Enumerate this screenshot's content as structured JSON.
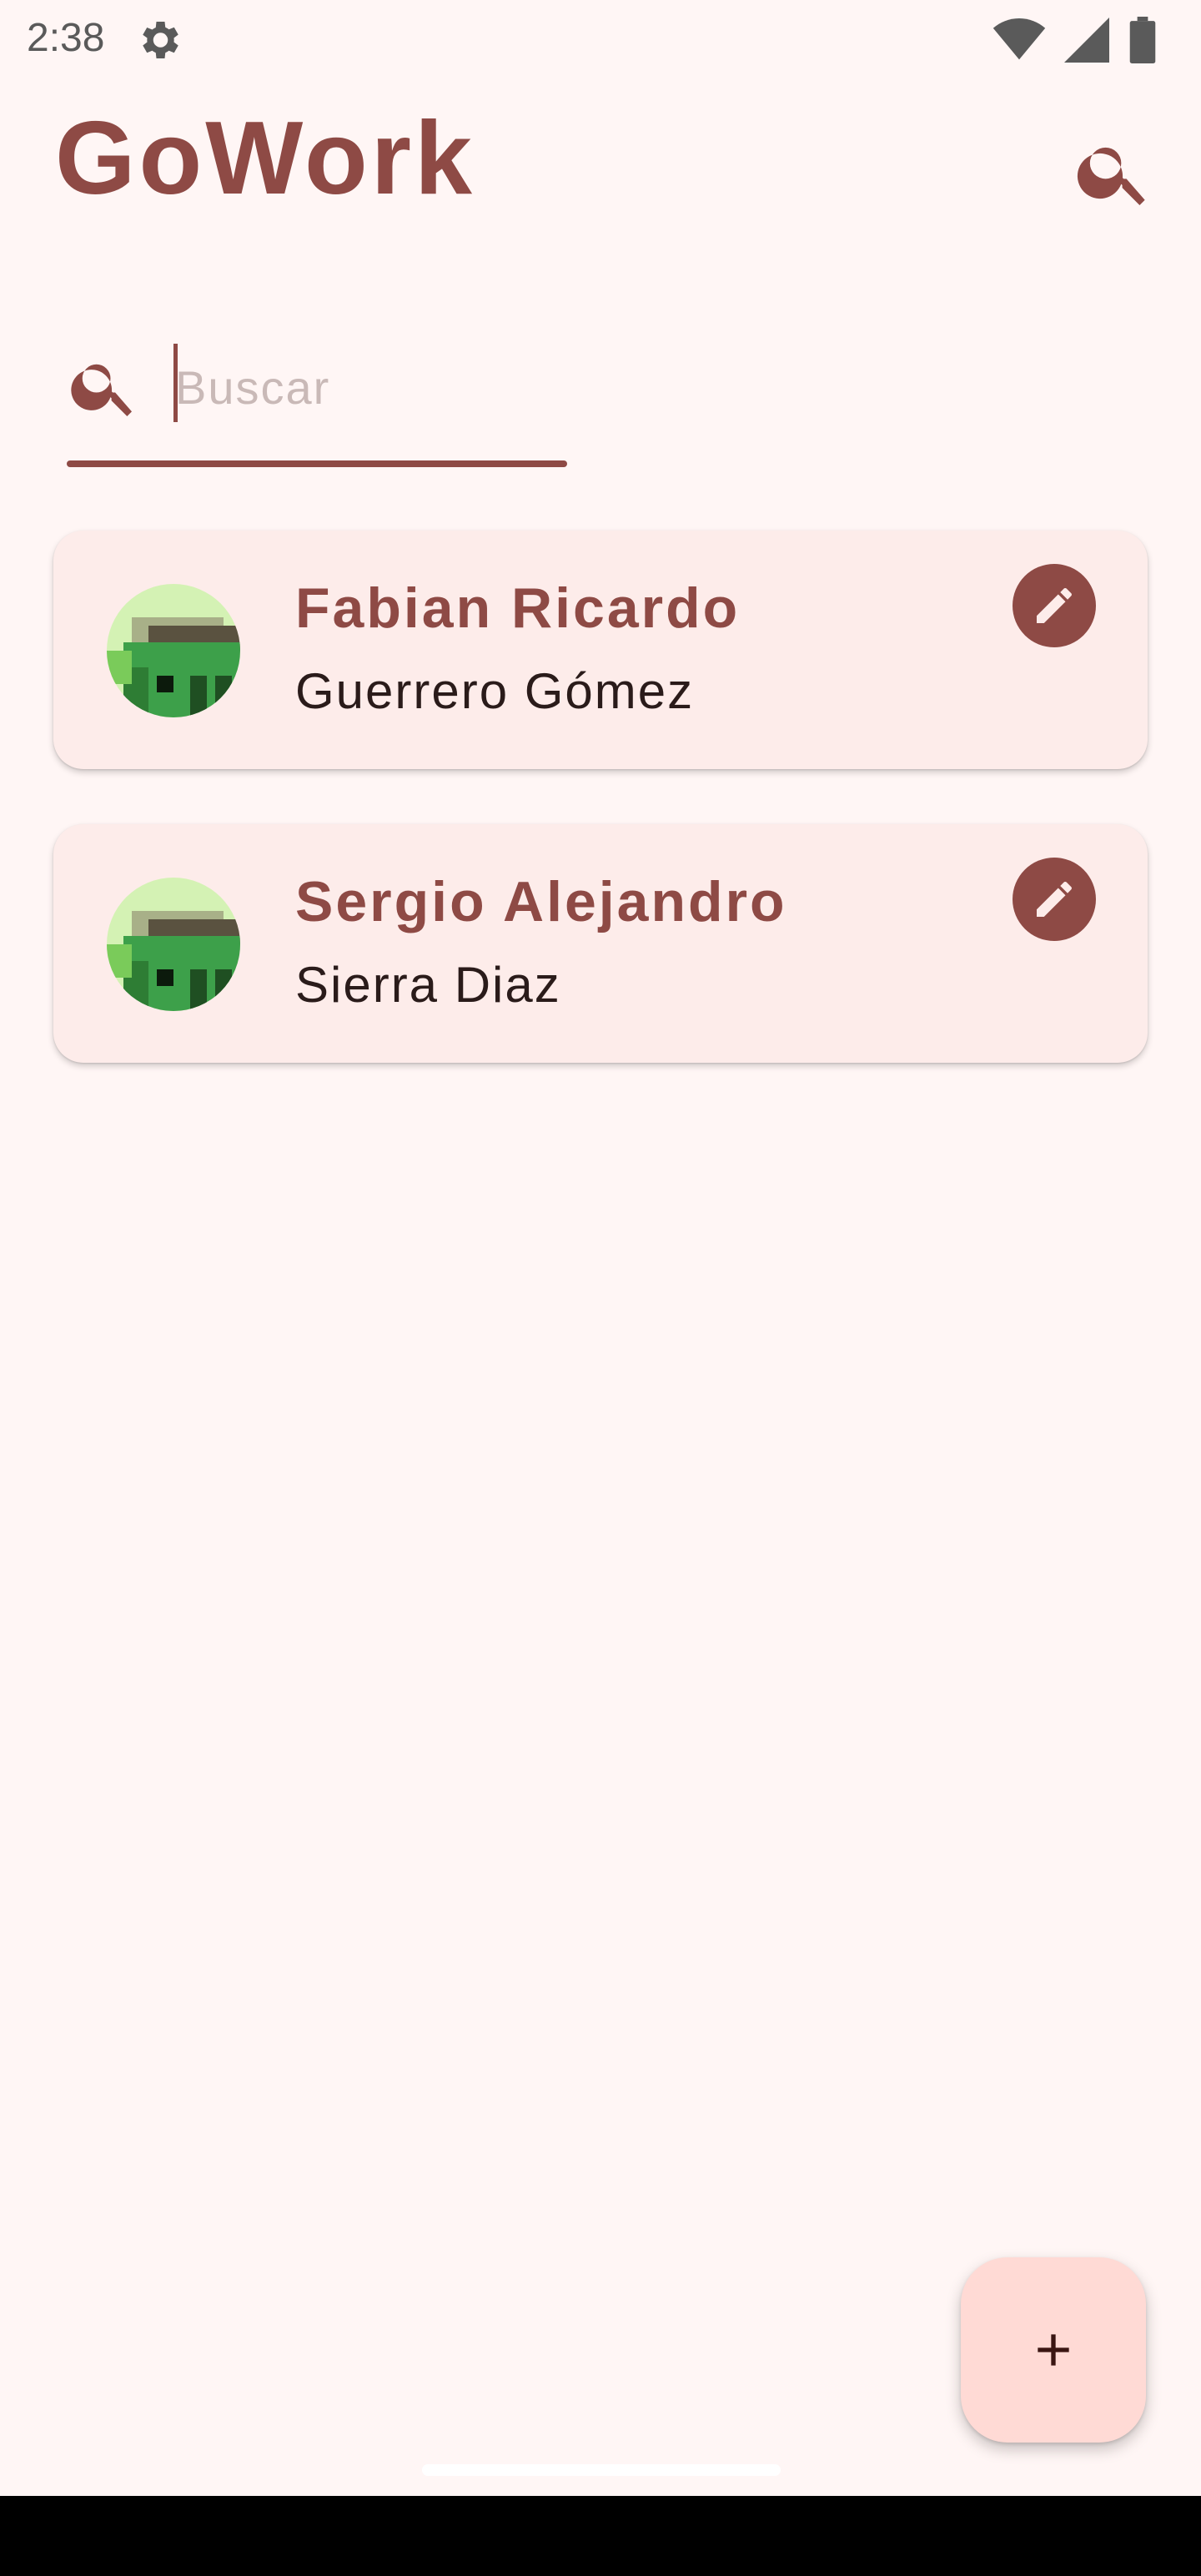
{
  "status_bar": {
    "time": "2:38",
    "icons": [
      "settings-gear-icon",
      "wifi-icon",
      "signal-icon",
      "battery-icon"
    ]
  },
  "app_bar": {
    "title": "GoWork",
    "search_icon": "search-icon"
  },
  "search": {
    "placeholder": "Buscar",
    "value": "",
    "icon": "search-icon"
  },
  "contacts": [
    {
      "first_name": "Fabian Ricardo",
      "last_name": "Guerrero Gómez",
      "avatar": "pixel-art-avatar",
      "action_icon": "edit-pencil-icon"
    },
    {
      "first_name": "Sergio Alejandro",
      "last_name": "Sierra Diaz",
      "avatar": "pixel-art-avatar",
      "action_icon": "edit-pencil-icon"
    }
  ],
  "fab": {
    "icon": "add-icon"
  },
  "colors": {
    "background": "#fff6f5",
    "primary": "#8e4a45",
    "card": "#fdecea",
    "fab": "#ffdad5"
  }
}
